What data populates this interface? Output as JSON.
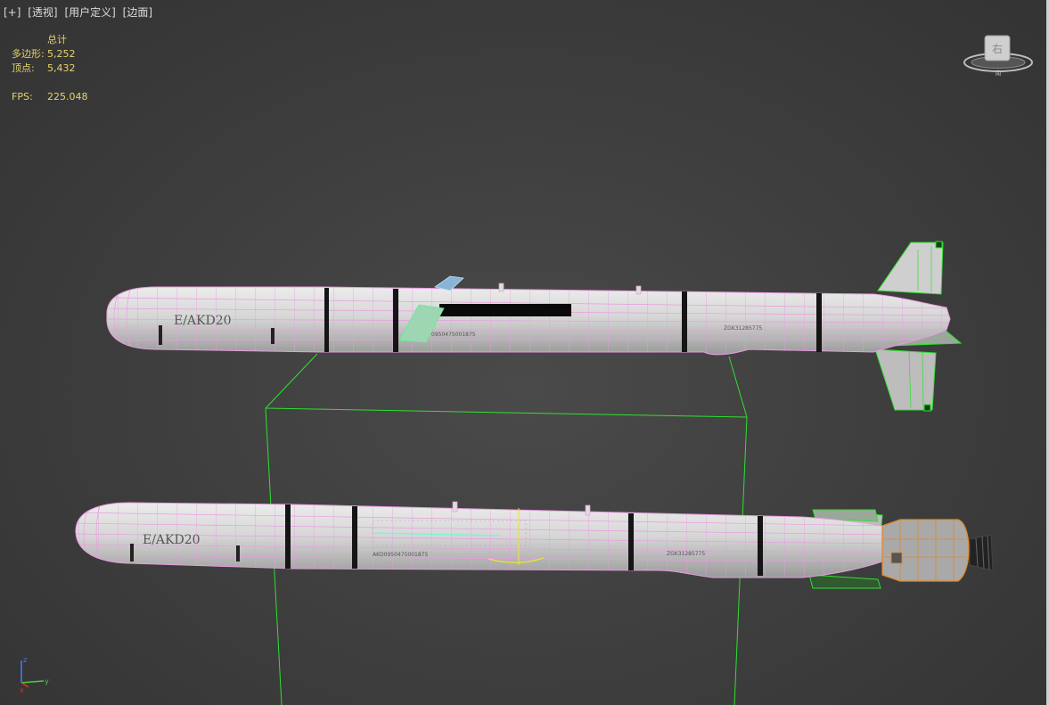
{
  "viewport": {
    "labels": [
      "[+]",
      "[透视]",
      "[用户定义]",
      "[边面]"
    ]
  },
  "stats": {
    "header": "总计",
    "polygons_label": "多边形:",
    "polygons_value": "5,252",
    "vertices_label": "顶点:",
    "vertices_value": "5,432",
    "fps_label": "FPS:",
    "fps_value": "225.048"
  },
  "viewcube": {
    "face_label": "右",
    "compass_label": "南"
  },
  "models": {
    "missile_top": {
      "marking": "E/AKD20",
      "serial_1": "0950475001875",
      "serial_2": "ZGK31285775"
    },
    "missile_bottom": {
      "marking": "E/AKD20",
      "serial_1": "AKD0950475001875",
      "serial_2": "ZGK31285775"
    }
  },
  "axis_gizmo": {
    "z": "z",
    "x": "x",
    "y": "y"
  },
  "colors": {
    "wire": "#e89ce0",
    "selection": "#2fe02f",
    "orange": "#e08a2c",
    "stats_text": "#e6d36a"
  }
}
